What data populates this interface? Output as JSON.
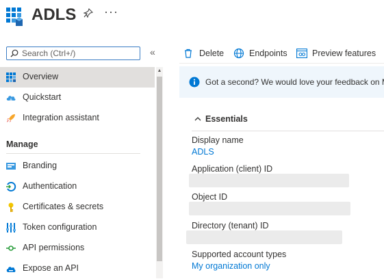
{
  "header": {
    "title": "ADLS"
  },
  "sidebar": {
    "search_placeholder": "Search (Ctrl+/)",
    "collapse_glyph": "«",
    "items": [
      {
        "label": "Overview",
        "icon": "grid-icon"
      },
      {
        "label": "Quickstart",
        "icon": "cloud-icon"
      },
      {
        "label": "Integration assistant",
        "icon": "rocket-icon"
      }
    ],
    "manage_title": "Manage",
    "manage_items": [
      {
        "label": "Branding",
        "icon": "branding-icon"
      },
      {
        "label": "Authentication",
        "icon": "authentication-icon"
      },
      {
        "label": "Certificates & secrets",
        "icon": "key-icon"
      },
      {
        "label": "Token configuration",
        "icon": "token-config-icon"
      },
      {
        "label": "API permissions",
        "icon": "api-permissions-icon"
      },
      {
        "label": "Expose an API",
        "icon": "cloud-api-icon"
      }
    ]
  },
  "toolbar": {
    "delete_label": "Delete",
    "endpoints_label": "Endpoints",
    "preview_label": "Preview features"
  },
  "feedback": {
    "text": "Got a second? We would love your feedback on Micr"
  },
  "essentials": {
    "title": "Essentials",
    "display_name_label": "Display name",
    "display_name_value": "ADLS",
    "app_id_label": "Application (client) ID",
    "object_id_label": "Object ID",
    "tenant_id_label": "Directory (tenant) ID",
    "account_types_label": "Supported account types",
    "account_types_value": "My organization only"
  },
  "colors": {
    "accent": "#0078d4",
    "selected_bg": "#e1dfdd",
    "banner_bg": "#eff6fc"
  }
}
